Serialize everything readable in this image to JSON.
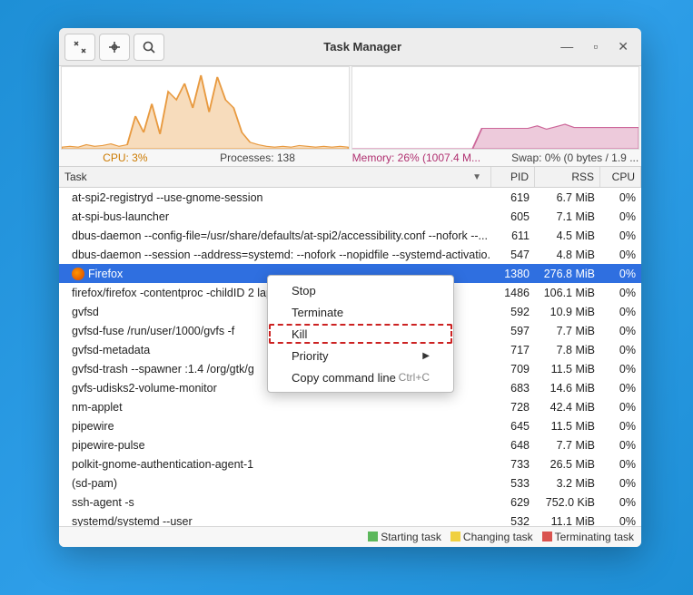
{
  "window": {
    "title": "Task Manager"
  },
  "status": {
    "cpu": "CPU: 3%",
    "processes": "Processes: 138",
    "memory": "Memory: 26% (1007.4 M...",
    "swap": "Swap: 0% (0 bytes / 1.9 ..."
  },
  "columns": {
    "task": "Task",
    "pid": "PID",
    "rss": "RSS",
    "cpu": "CPU"
  },
  "rows": [
    {
      "task": "at-spi2-registryd --use-gnome-session",
      "pid": "619",
      "rss": "6.7 MiB",
      "cpu": "0%"
    },
    {
      "task": "at-spi-bus-launcher",
      "pid": "605",
      "rss": "7.1 MiB",
      "cpu": "0%"
    },
    {
      "task": "dbus-daemon --config-file=/usr/share/defaults/at-spi2/accessibility.conf --nofork --...",
      "pid": "611",
      "rss": "4.5 MiB",
      "cpu": "0%"
    },
    {
      "task": "dbus-daemon --session --address=systemd: --nofork --nopidfile --systemd-activatio...",
      "pid": "547",
      "rss": "4.8 MiB",
      "cpu": "0%"
    },
    {
      "task": "Firefox",
      "pid": "1380",
      "rss": "276.8 MiB",
      "cpu": "0%",
      "selected": true,
      "icon": "firefox"
    },
    {
      "task": "firefox/firefox -contentproc -childID 2                                 lapSize ...",
      "pid": "1486",
      "rss": "106.1 MiB",
      "cpu": "0%"
    },
    {
      "task": "gvfsd",
      "pid": "592",
      "rss": "10.9 MiB",
      "cpu": "0%"
    },
    {
      "task": "gvfsd-fuse /run/user/1000/gvfs -f",
      "pid": "597",
      "rss": "7.7 MiB",
      "cpu": "0%"
    },
    {
      "task": "gvfsd-metadata",
      "pid": "717",
      "rss": "7.8 MiB",
      "cpu": "0%"
    },
    {
      "task": "gvfsd-trash --spawner :1.4 /org/gtk/g",
      "pid": "709",
      "rss": "11.5 MiB",
      "cpu": "0%"
    },
    {
      "task": "gvfs-udisks2-volume-monitor",
      "pid": "683",
      "rss": "14.6 MiB",
      "cpu": "0%"
    },
    {
      "task": "nm-applet",
      "pid": "728",
      "rss": "42.4 MiB",
      "cpu": "0%"
    },
    {
      "task": "pipewire",
      "pid": "645",
      "rss": "11.5 MiB",
      "cpu": "0%"
    },
    {
      "task": "pipewire-pulse",
      "pid": "648",
      "rss": "7.7 MiB",
      "cpu": "0%"
    },
    {
      "task": "polkit-gnome-authentication-agent-1",
      "pid": "733",
      "rss": "26.5 MiB",
      "cpu": "0%"
    },
    {
      "task": "(sd-pam)",
      "pid": "533",
      "rss": "3.2 MiB",
      "cpu": "0%"
    },
    {
      "task": "ssh-agent -s",
      "pid": "629",
      "rss": "752.0 KiB",
      "cpu": "0%"
    },
    {
      "task": "systemd/systemd --user",
      "pid": "532",
      "rss": "11.1 MiB",
      "cpu": "0%"
    }
  ],
  "legend": {
    "starting": "Starting task",
    "changing": "Changing task",
    "terminating": "Terminating task"
  },
  "legend_colors": {
    "starting": "#5cb85c",
    "changing": "#f0d040",
    "terminating": "#d9534f"
  },
  "context_menu": {
    "stop": "Stop",
    "terminate": "Terminate",
    "kill": "Kill",
    "priority": "Priority",
    "copy": "Copy command line",
    "copy_shortcut": "Ctrl+C"
  },
  "chart_data": [
    {
      "type": "area",
      "name": "cpu-graph",
      "color": "#e89a40",
      "ylim": [
        0,
        100
      ],
      "values": [
        2,
        3,
        2,
        5,
        3,
        4,
        6,
        3,
        5,
        40,
        20,
        55,
        18,
        70,
        60,
        80,
        50,
        90,
        45,
        88,
        60,
        50,
        20,
        8,
        5,
        3,
        2,
        3,
        2,
        4,
        3,
        2,
        3,
        2,
        3,
        2
      ]
    },
    {
      "type": "area",
      "name": "memory-graph",
      "color": "#cc6699",
      "ylim": [
        0,
        100
      ],
      "values": [
        0,
        0,
        0,
        0,
        0,
        0,
        0,
        0,
        0,
        0,
        0,
        0,
        0,
        0,
        25,
        25,
        25,
        25,
        25,
        25,
        28,
        24,
        27,
        30,
        26,
        26,
        26,
        26,
        26,
        26,
        26,
        26
      ]
    }
  ]
}
